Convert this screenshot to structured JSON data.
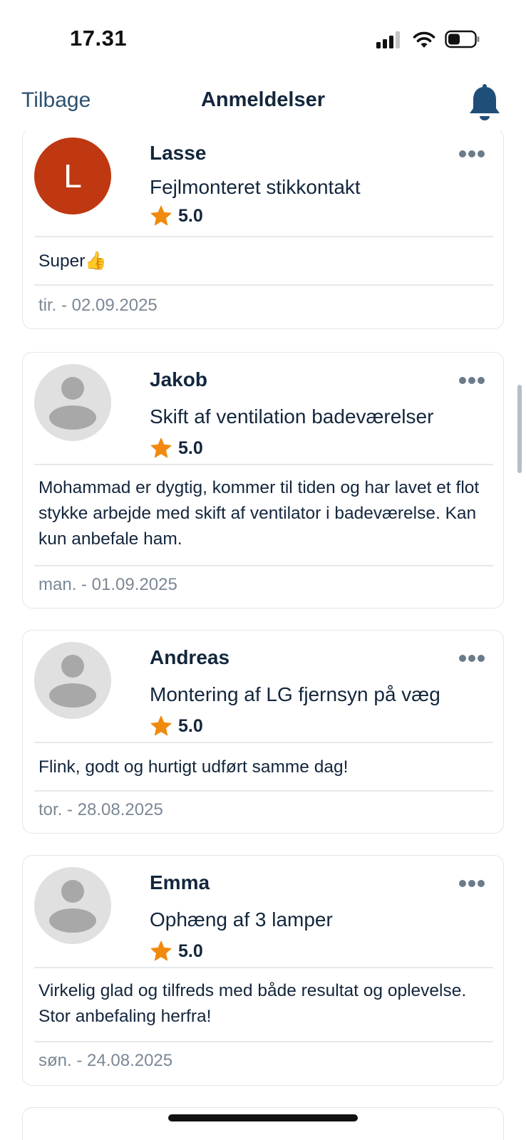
{
  "status_bar": {
    "time": "17.31"
  },
  "nav": {
    "back_label": "Tilbage",
    "title": "Anmeldelser"
  },
  "reviews": [
    {
      "avatar_letter": "L",
      "name": "Lasse",
      "job": "Fejlmonteret stikkontakt",
      "rating": "5.0",
      "comment": "Super👍",
      "date": "tir. - 02.09.2025"
    },
    {
      "avatar_letter": "",
      "name": "Jakob",
      "job": "Skift af ventilation badeværelser",
      "rating": "5.0",
      "comment": "Mohammad er dygtig, kommer til tiden og har lavet et flot stykke arbejde med skift af ventilator i badeværelse. Kan kun anbefale ham.",
      "date": "man. - 01.09.2025"
    },
    {
      "avatar_letter": "",
      "name": "Andreas",
      "job": "Montering af LG fjernsyn på væg",
      "rating": "5.0",
      "comment": "Flink, godt og hurtigt udført samme dag!",
      "date": "tor. - 28.08.2025"
    },
    {
      "avatar_letter": "",
      "name": "Emma",
      "job": "Ophæng af 3 lamper",
      "rating": "5.0",
      "comment": "Virkelig glad og tilfreds med både resultat og oplevelse. Stor anbefaling herfra!",
      "date": "søn. - 24.08.2025"
    }
  ],
  "colors": {
    "primary_text": "#13263c",
    "link": "#2b5170",
    "bell": "#1f4e79",
    "star": "#f08a0c",
    "avatar_initial_bg": "#bf3811",
    "avatar_placeholder_bg": "#e0e0e0",
    "date_text": "#7b8895"
  },
  "icons": {
    "status": [
      "cellular-signal-icon",
      "wifi-icon",
      "battery-icon"
    ],
    "nav": "bell-icon",
    "review": [
      "avatar-placeholder-icon",
      "star-icon",
      "more-options-icon"
    ]
  }
}
